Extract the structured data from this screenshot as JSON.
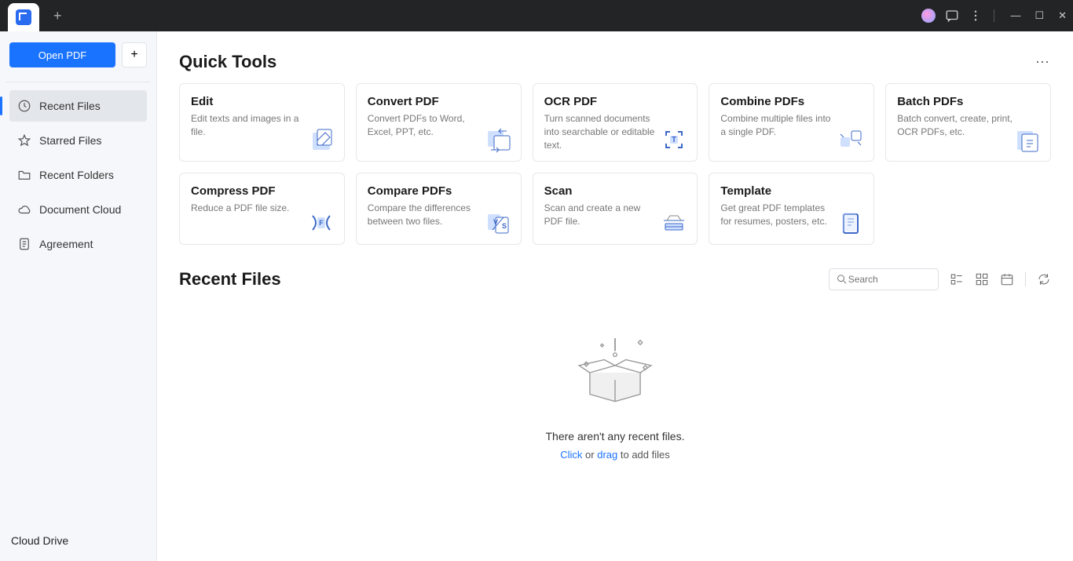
{
  "titlebar": {
    "icons": {
      "avatar": "avatar",
      "chat": "chat",
      "menu": "menu",
      "minimize": "—",
      "maximize": "☐",
      "close": "✕"
    }
  },
  "sidebar": {
    "open_label": "Open PDF",
    "items": [
      {
        "id": "recent-files",
        "label": "Recent Files",
        "icon": "clock",
        "active": true
      },
      {
        "id": "starred-files",
        "label": "Starred Files",
        "icon": "star",
        "active": false
      },
      {
        "id": "recent-folders",
        "label": "Recent Folders",
        "icon": "folder",
        "active": false
      },
      {
        "id": "document-cloud",
        "label": "Document Cloud",
        "icon": "cloud",
        "active": false
      },
      {
        "id": "agreement",
        "label": "Agreement",
        "icon": "doc",
        "active": false
      }
    ],
    "bottom_label": "Cloud Drive"
  },
  "quick_tools": {
    "title": "Quick Tools",
    "cards": [
      {
        "id": "edit",
        "title": "Edit",
        "desc": "Edit texts and images in a file."
      },
      {
        "id": "convert",
        "title": "Convert PDF",
        "desc": "Convert PDFs to Word, Excel, PPT, etc."
      },
      {
        "id": "ocr",
        "title": "OCR PDF",
        "desc": "Turn scanned documents into searchable or editable text."
      },
      {
        "id": "combine",
        "title": "Combine PDFs",
        "desc": "Combine multiple files into a single PDF."
      },
      {
        "id": "batch",
        "title": "Batch PDFs",
        "desc": "Batch convert, create, print, OCR PDFs, etc."
      },
      {
        "id": "compress",
        "title": "Compress PDF",
        "desc": "Reduce a PDF file size."
      },
      {
        "id": "compare",
        "title": "Compare PDFs",
        "desc": "Compare the differences between two files."
      },
      {
        "id": "scan",
        "title": "Scan",
        "desc": "Scan and create a new PDF file."
      },
      {
        "id": "template",
        "title": "Template",
        "desc": "Get great PDF templates for resumes, posters, etc."
      }
    ]
  },
  "recent": {
    "title": "Recent Files",
    "search_placeholder": "Search",
    "empty_main": "There aren't any recent files.",
    "empty_click": "Click",
    "empty_or": " or ",
    "empty_drag": "drag",
    "empty_tail": " to add files"
  }
}
